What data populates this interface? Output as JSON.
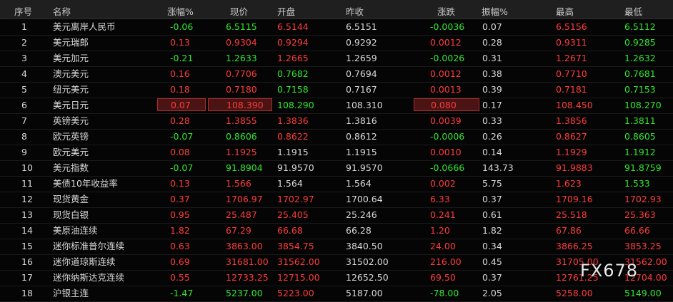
{
  "columns": [
    "序号",
    "名称",
    "涨幅%",
    "现价",
    "开盘",
    "昨收",
    "涨跌",
    "振幅%",
    "最高",
    "最低"
  ],
  "rows": [
    {
      "no": "1",
      "name": "美元离岸人民币",
      "pct": "-0.06",
      "price": "6.5115",
      "open": "6.5144",
      "prev": "6.5151",
      "chg": "-0.0036",
      "amp": "0.07",
      "high": "6.5156",
      "low": "6.5112",
      "dir": "down",
      "openDir": "up",
      "highDir": "up",
      "lowDir": "down"
    },
    {
      "no": "2",
      "name": "美元瑞郎",
      "pct": "0.13",
      "price": "0.9304",
      "open": "0.9294",
      "prev": "0.9292",
      "chg": "0.0012",
      "amp": "0.28",
      "high": "0.9311",
      "low": "0.9285",
      "dir": "up",
      "openDir": "up",
      "highDir": "up",
      "lowDir": "down"
    },
    {
      "no": "3",
      "name": "美元加元",
      "pct": "-0.21",
      "price": "1.2633",
      "open": "1.2665",
      "prev": "1.2659",
      "chg": "-0.0026",
      "amp": "0.31",
      "high": "1.2671",
      "low": "1.2632",
      "dir": "down",
      "openDir": "up",
      "highDir": "up",
      "lowDir": "down"
    },
    {
      "no": "4",
      "name": "澳元美元",
      "pct": "0.16",
      "price": "0.7706",
      "open": "0.7682",
      "prev": "0.7694",
      "chg": "0.0012",
      "amp": "0.38",
      "high": "0.7710",
      "low": "0.7681",
      "dir": "up",
      "openDir": "down",
      "highDir": "up",
      "lowDir": "down"
    },
    {
      "no": "5",
      "name": "纽元美元",
      "pct": "0.18",
      "price": "0.7180",
      "open": "0.7158",
      "prev": "0.7167",
      "chg": "0.0013",
      "amp": "0.39",
      "high": "0.7181",
      "low": "0.7153",
      "dir": "up",
      "openDir": "down",
      "highDir": "up",
      "lowDir": "down"
    },
    {
      "no": "6",
      "name": "美元日元",
      "pct": "0.07",
      "price": "108.390",
      "open": "108.290",
      "prev": "108.310",
      "chg": "0.080",
      "amp": "0.17",
      "high": "108.450",
      "low": "108.270",
      "dir": "up",
      "openDir": "down",
      "highDir": "up",
      "lowDir": "down",
      "highlight": true
    },
    {
      "no": "7",
      "name": "英镑美元",
      "pct": "0.28",
      "price": "1.3855",
      "open": "1.3836",
      "prev": "1.3816",
      "chg": "0.0039",
      "amp": "0.33",
      "high": "1.3856",
      "low": "1.3811",
      "dir": "up",
      "openDir": "up",
      "highDir": "up",
      "lowDir": "down"
    },
    {
      "no": "8",
      "name": "欧元英镑",
      "pct": "-0.07",
      "price": "0.8606",
      "open": "0.8622",
      "prev": "0.8612",
      "chg": "-0.0006",
      "amp": "0.26",
      "high": "0.8627",
      "low": "0.8605",
      "dir": "down",
      "openDir": "up",
      "highDir": "up",
      "lowDir": "down"
    },
    {
      "no": "9",
      "name": "欧元美元",
      "pct": "0.08",
      "price": "1.1925",
      "open": "1.1915",
      "prev": "1.1915",
      "chg": "0.0010",
      "amp": "0.14",
      "high": "1.1929",
      "low": "1.1912",
      "dir": "up",
      "openDir": "flat",
      "highDir": "up",
      "lowDir": "down"
    },
    {
      "no": "10",
      "name": "美元指数",
      "pct": "-0.07",
      "price": "91.8904",
      "open": "91.9570",
      "prev": "91.9570",
      "chg": "-0.0666",
      "amp": "143.73",
      "high": "91.9883",
      "low": "91.8759",
      "dir": "down",
      "openDir": "flat",
      "highDir": "up",
      "lowDir": "down"
    },
    {
      "no": "11",
      "name": "美债10年收益率",
      "pct": "0.13",
      "price": "1.566",
      "open": "1.564",
      "prev": "1.564",
      "chg": "0.002",
      "amp": "5.75",
      "high": "1.623",
      "low": "1.533",
      "dir": "up",
      "openDir": "flat",
      "highDir": "up",
      "lowDir": "down"
    },
    {
      "no": "12",
      "name": "现货黄金",
      "pct": "0.37",
      "price": "1706.97",
      "open": "1702.97",
      "prev": "1700.64",
      "chg": "6.33",
      "amp": "0.37",
      "high": "1709.16",
      "low": "1702.93",
      "dir": "up",
      "openDir": "up",
      "highDir": "up",
      "lowDir": "up"
    },
    {
      "no": "13",
      "name": "现货白银",
      "pct": "0.95",
      "price": "25.487",
      "open": "25.405",
      "prev": "25.246",
      "chg": "0.241",
      "amp": "0.61",
      "high": "25.518",
      "low": "25.363",
      "dir": "up",
      "openDir": "up",
      "highDir": "up",
      "lowDir": "up"
    },
    {
      "no": "14",
      "name": "美原油连续",
      "pct": "1.82",
      "price": "67.29",
      "open": "66.68",
      "prev": "66.28",
      "chg": "1.20",
      "amp": "1.82",
      "high": "67.86",
      "low": "66.66",
      "dir": "up",
      "openDir": "up",
      "highDir": "up",
      "lowDir": "up"
    },
    {
      "no": "15",
      "name": "迷你标准普尔连续",
      "pct": "0.63",
      "price": "3863.00",
      "open": "3854.75",
      "prev": "3840.50",
      "chg": "24.00",
      "amp": "0.34",
      "high": "3866.25",
      "low": "3853.25",
      "dir": "up",
      "openDir": "up",
      "highDir": "up",
      "lowDir": "up"
    },
    {
      "no": "16",
      "name": "迷你道琼斯连续",
      "pct": "0.69",
      "price": "31681.00",
      "open": "31562.00",
      "prev": "31502.00",
      "chg": "216.00",
      "amp": "0.45",
      "high": "31705.00",
      "low": "31562.00",
      "dir": "up",
      "openDir": "up",
      "highDir": "up",
      "lowDir": "up"
    },
    {
      "no": "17",
      "name": "迷你纳斯达克连续",
      "pct": "0.55",
      "price": "12733.25",
      "open": "12715.00",
      "prev": "12652.50",
      "chg": "69.50",
      "amp": "0.37",
      "high": "12761.25",
      "low": "12704.00",
      "dir": "up",
      "openDir": "up",
      "highDir": "up",
      "lowDir": "up"
    },
    {
      "no": "18",
      "name": "沪银主连",
      "pct": "-1.47",
      "price": "5237.00",
      "open": "5223.00",
      "prev": "5187.00",
      "chg": "-78.00",
      "amp": "2.05",
      "high": "5258.00",
      "low": "5149.00",
      "dir": "down",
      "openDir": "up",
      "highDir": "up",
      "lowDir": "down"
    }
  ],
  "watermark": "FX678",
  "colors": {
    "up": "#ff3b3b",
    "down": "#2ee62e",
    "neutral": "#d8d8d8",
    "header_bg": "#1f1f1f",
    "bg": "#050505"
  }
}
